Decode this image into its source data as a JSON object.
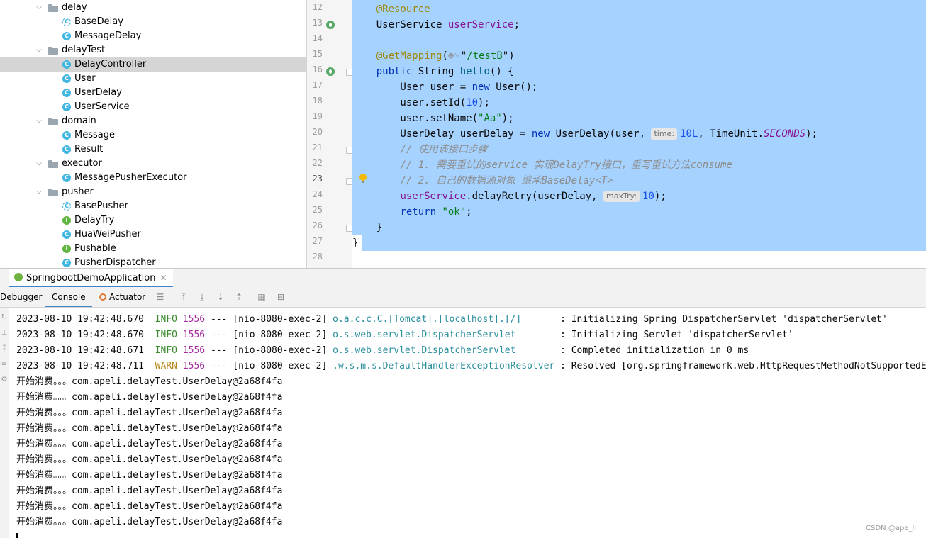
{
  "project_tree": {
    "rows": [
      {
        "type": "folder",
        "label": "delay",
        "expanded": true,
        "depth": 0
      },
      {
        "type": "abstract-class",
        "label": "BaseDelay",
        "depth": 1
      },
      {
        "type": "class",
        "label": "MessageDelay",
        "depth": 1
      },
      {
        "type": "folder",
        "label": "delayTest",
        "expanded": true,
        "depth": 0
      },
      {
        "type": "class",
        "label": "DelayController",
        "depth": 1,
        "selected": true
      },
      {
        "type": "class",
        "label": "User",
        "depth": 1
      },
      {
        "type": "class",
        "label": "UserDelay",
        "depth": 1
      },
      {
        "type": "class",
        "label": "UserService",
        "depth": 1
      },
      {
        "type": "folder",
        "label": "domain",
        "expanded": true,
        "depth": 0
      },
      {
        "type": "class",
        "label": "Message",
        "depth": 1
      },
      {
        "type": "class",
        "label": "Result",
        "depth": 1
      },
      {
        "type": "folder",
        "label": "executor",
        "expanded": true,
        "depth": 0
      },
      {
        "type": "class",
        "label": "MessagePusherExecutor",
        "depth": 1
      },
      {
        "type": "folder",
        "label": "pusher",
        "expanded": true,
        "depth": 0
      },
      {
        "type": "abstract-class",
        "label": "BasePusher",
        "depth": 1
      },
      {
        "type": "interface",
        "label": "DelayTry",
        "depth": 1
      },
      {
        "type": "class",
        "label": "HuaWeiPusher",
        "depth": 1
      },
      {
        "type": "interface",
        "label": "Pushable",
        "depth": 1
      },
      {
        "type": "class",
        "label": "PusherDispatcher",
        "depth": 1
      }
    ]
  },
  "editor": {
    "line_numbers": [
      "12",
      "13",
      "14",
      "15",
      "16",
      "17",
      "18",
      "19",
      "20",
      "21",
      "22",
      "23",
      "24",
      "25",
      "26",
      "27",
      "28"
    ],
    "current_line": "23",
    "code": [
      [
        {
          "t": "    "
        },
        {
          "t": "@Resource",
          "c": "ann"
        }
      ],
      [
        {
          "t": "    UserService "
        },
        {
          "t": "userService",
          "c": "fld"
        },
        {
          "t": ";"
        }
      ],
      [],
      [
        {
          "t": "    "
        },
        {
          "t": "@GetMapping",
          "c": "ann"
        },
        {
          "t": "("
        },
        {
          "t": "⊕˅",
          "c": "cmt"
        },
        {
          "t": "\""
        },
        {
          "t": "/testB",
          "c": "url"
        },
        {
          "t": "\")"
        }
      ],
      [
        {
          "t": "    "
        },
        {
          "t": "public",
          "c": "kw"
        },
        {
          "t": " String "
        },
        {
          "t": "hello",
          "c": "fn"
        },
        {
          "t": "() {"
        }
      ],
      [
        {
          "t": "        User user = "
        },
        {
          "t": "new",
          "c": "kw"
        },
        {
          "t": " User();"
        }
      ],
      [
        {
          "t": "        user.setId("
        },
        {
          "t": "10",
          "c": "num"
        },
        {
          "t": ");"
        }
      ],
      [
        {
          "t": "        user.setName("
        },
        {
          "t": "\"Aa\"",
          "c": "str"
        },
        {
          "t": ");"
        }
      ],
      [
        {
          "t": "        UserDelay userDelay = "
        },
        {
          "t": "new",
          "c": "kw"
        },
        {
          "t": " UserDelay(user, "
        },
        {
          "t": "time:",
          "c": "hint"
        },
        {
          "t": "10L",
          "c": "num"
        },
        {
          "t": ", TimeUnit."
        },
        {
          "t": "SECONDS",
          "c": "stat"
        },
        {
          "t": ");"
        }
      ],
      [
        {
          "t": "        "
        },
        {
          "t": "// 使用该接口步骤",
          "c": "cmt"
        }
      ],
      [
        {
          "t": "        "
        },
        {
          "t": "// 1. 需要重试的service 实现DelayTry接口，重写重试方法consume",
          "c": "cmt"
        }
      ],
      [
        {
          "t": "        "
        },
        {
          "t": "// 2. 自己的数据源对象 继承BaseDelay<T>",
          "c": "cmt"
        }
      ],
      [
        {
          "t": "        "
        },
        {
          "t": "userService",
          "c": "fld"
        },
        {
          "t": ".delayRetry(userDelay, "
        },
        {
          "t": "maxTry:",
          "c": "hint"
        },
        {
          "t": "10",
          "c": "num"
        },
        {
          "t": ");"
        }
      ],
      [
        {
          "t": "        "
        },
        {
          "t": "return",
          "c": "kw"
        },
        {
          "t": " "
        },
        {
          "t": "\"ok\"",
          "c": "str"
        },
        {
          "t": ";"
        }
      ],
      [
        {
          "t": "    }"
        }
      ],
      [
        {
          "t": "}"
        }
      ],
      []
    ]
  },
  "run_window": {
    "tab_label": "SpringbootDemoApplication",
    "toolbar": {
      "debugger_label": "Debugger",
      "console_label": "Console",
      "actuator_label": "Actuator"
    },
    "log_lines": [
      {
        "ts": "2023-08-10 19:42:48.670",
        "level": "INFO",
        "pid": "1556",
        "sep": "---",
        "thread": "[nio-8080-exec-2]",
        "logger": "o.a.c.c.C.[Tomcat].[localhost].[/]      ",
        "msg": ": Initializing Spring DispatcherServlet 'dispatcherServlet'"
      },
      {
        "ts": "2023-08-10 19:42:48.670",
        "level": "INFO",
        "pid": "1556",
        "sep": "---",
        "thread": "[nio-8080-exec-2]",
        "logger": "o.s.web.servlet.DispatcherServlet       ",
        "msg": ": Initializing Servlet 'dispatcherServlet'"
      },
      {
        "ts": "2023-08-10 19:42:48.671",
        "level": "INFO",
        "pid": "1556",
        "sep": "---",
        "thread": "[nio-8080-exec-2]",
        "logger": "o.s.web.servlet.DispatcherServlet       ",
        "msg": ": Completed initialization in 0 ms"
      },
      {
        "ts": "2023-08-10 19:42:48.711",
        "level": "WARN",
        "pid": "1556",
        "sep": "---",
        "thread": "[nio-8080-exec-2]",
        "logger": ".w.s.m.s.DefaultHandlerExceptionResolver",
        "msg": ": Resolved [org.springframework.web.HttpRequestMethodNotSupportedException"
      }
    ],
    "output_lines": [
      "开始消费。。。com.apeli.delayTest.UserDelay@2a68f4fa",
      "开始消费。。。com.apeli.delayTest.UserDelay@2a68f4fa",
      "开始消费。。。com.apeli.delayTest.UserDelay@2a68f4fa",
      "开始消费。。。com.apeli.delayTest.UserDelay@2a68f4fa",
      "开始消费。。。com.apeli.delayTest.UserDelay@2a68f4fa",
      "开始消费。。。com.apeli.delayTest.UserDelay@2a68f4fa",
      "开始消费。。。com.apeli.delayTest.UserDelay@2a68f4fa",
      "开始消费。。。com.apeli.delayTest.UserDelay@2a68f4fa",
      "开始消费。。。com.apeli.delayTest.UserDelay@2a68f4fa",
      "开始消费。。。com.apeli.delayTest.UserDelay@2a68f4fa"
    ]
  },
  "watermark": "CSDN @ape_ll",
  "colors": {
    "selection": "#a6d2ff",
    "selected_tree_row": "#d5d5d5",
    "keyword": "#0033b3",
    "annotation": "#9e880d",
    "string": "#067d17",
    "number": "#1750eb",
    "field": "#871094"
  }
}
